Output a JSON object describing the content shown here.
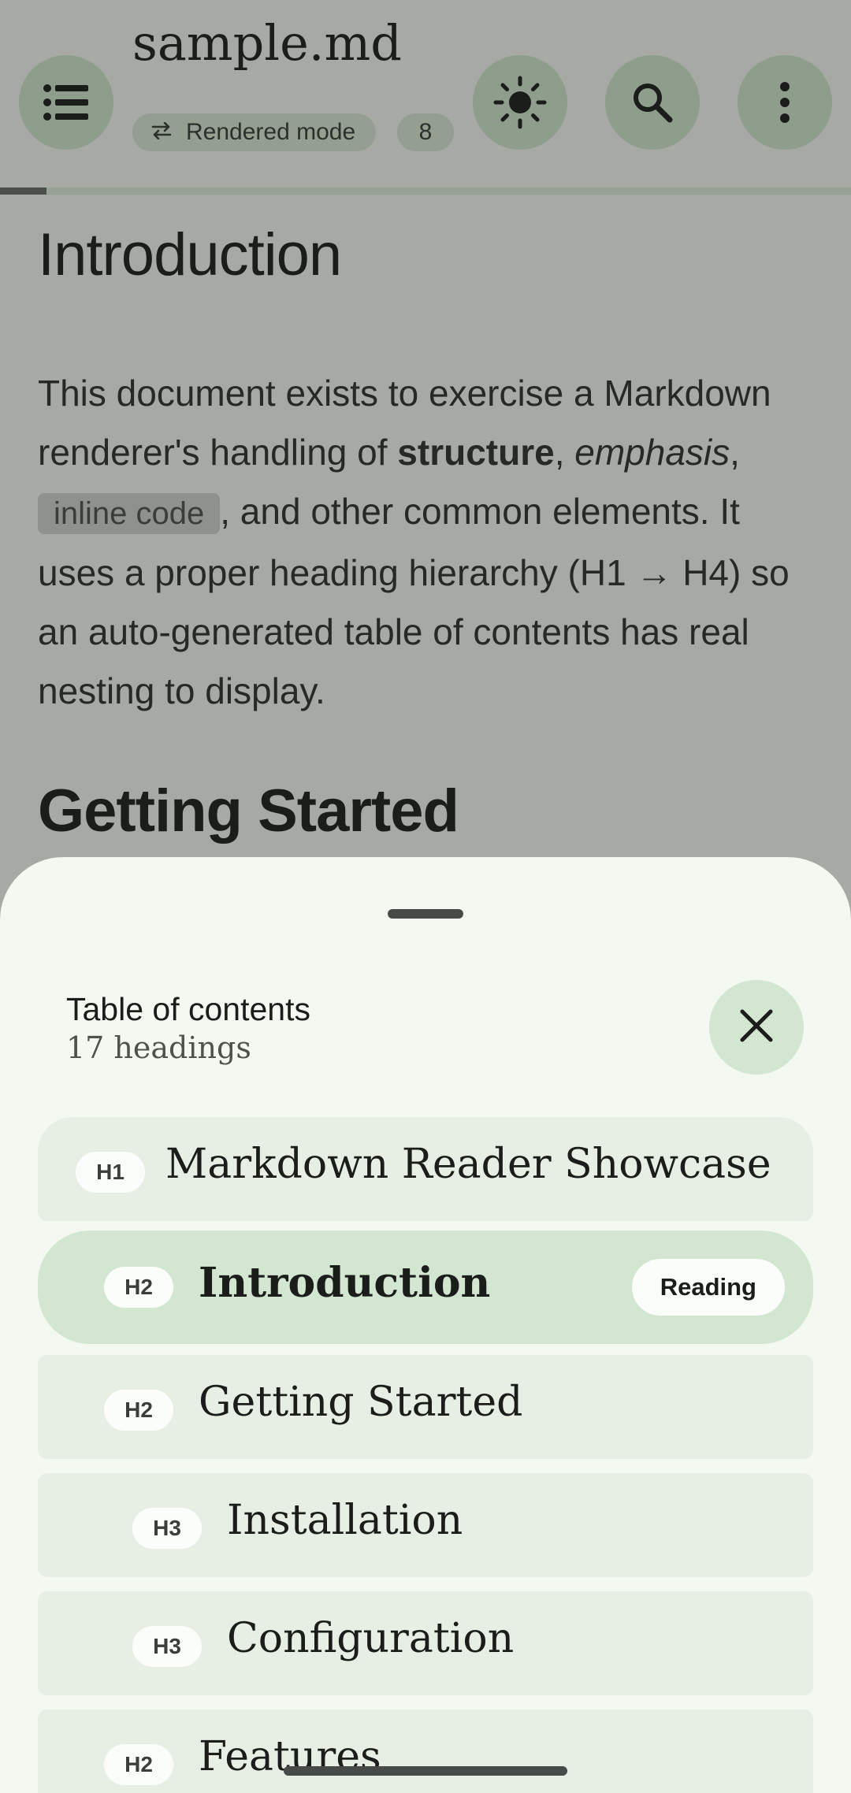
{
  "appbar": {
    "doc_title": "sample.md",
    "mode_label": "Rendered mode",
    "heading_count_badge": "8",
    "read_progress": 0.055,
    "icons": {
      "toc": "list-icon",
      "theme": "sun-icon",
      "search": "search-icon",
      "more": "more-vert-icon",
      "mode": "swap-horizontal-icon"
    }
  },
  "document": {
    "heading_1": "Introduction",
    "paragraph": {
      "t1": "This document exists to exercise a Markdown renderer's handling of ",
      "bold": "structure",
      "t2": ", ",
      "italic": "emphasis",
      "t3": ",",
      "code": "inline code",
      "t4": ", and other common elements. It uses a proper heading hierarchy (H1 → H4) so an auto-generated table of contents has real nesting to display."
    },
    "heading_2": "Getting Started"
  },
  "sheet": {
    "title": "Table of contents",
    "subtitle": "17 headings",
    "close_icon": "close-icon",
    "reading_label": "Reading",
    "items": [
      {
        "level": "H1",
        "label": "Markdown Reader Showcase",
        "active": false
      },
      {
        "level": "H2",
        "label": "Introduction",
        "active": true
      },
      {
        "level": "H2",
        "label": "Getting Started",
        "active": false
      },
      {
        "level": "H3",
        "label": "Installation",
        "active": false
      },
      {
        "level": "H3",
        "label": "Configuration",
        "active": false
      },
      {
        "level": "H2",
        "label": "Features",
        "active": false
      }
    ]
  },
  "colors": {
    "scrim_background": "#a6a9a4",
    "sheet_background": "#f3f8f1",
    "toc_item": "#e7efe5",
    "toc_item_active": "#d2e6d1"
  }
}
